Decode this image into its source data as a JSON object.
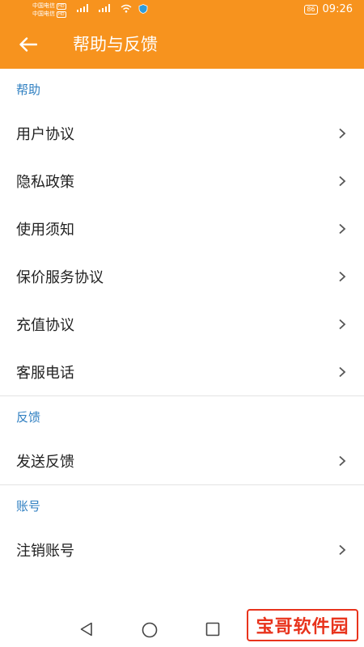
{
  "status": {
    "carrier_1": "中国电信",
    "carrier_2": "中国电信",
    "hd": "HD",
    "network": "4G",
    "battery": "86",
    "time": "09:26"
  },
  "header": {
    "title": "帮助与反馈"
  },
  "sections": [
    {
      "title": "帮助",
      "items": [
        "用户协议",
        "隐私政策",
        "使用须知",
        "保价服务协议",
        "充值协议",
        "客服电话"
      ]
    },
    {
      "title": "反馈",
      "items": [
        "发送反馈"
      ]
    },
    {
      "title": "账号",
      "items": [
        "注销账号"
      ]
    }
  ],
  "watermark": "宝哥软件园",
  "colors": {
    "header": "#f7931e",
    "section_title": "#2f7fc1",
    "watermark": "#e8331c"
  },
  "icons": {
    "back": "arrow-left-icon",
    "item": "chevron-right-icon",
    "nav": [
      "back-triangle-icon",
      "home-circle-icon",
      "recents-square-icon"
    ]
  }
}
